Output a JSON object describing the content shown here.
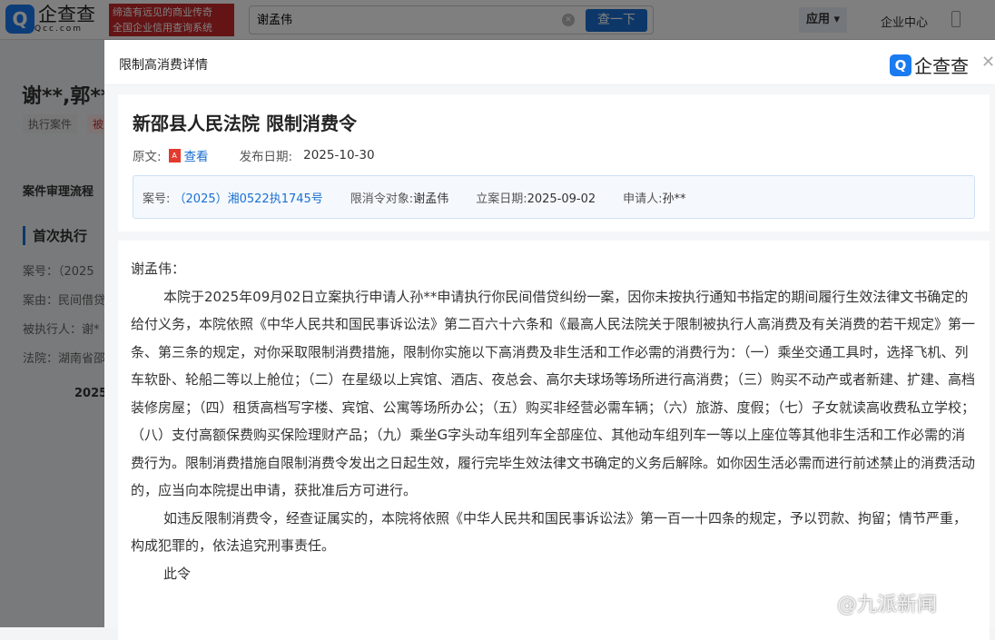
{
  "topbar": {
    "logo_mark": "Q",
    "logo_text": "企查查",
    "logo_sub": "Qcc.com",
    "slogan1": "缔造有远见的商业传奇",
    "slogan2": "全国企业信用查询系统",
    "search_value": "谢孟伟",
    "search_button": "查一下",
    "apps": "应用 ▾",
    "enterprise": "企业中心"
  },
  "background": {
    "title": "谢**,郭**",
    "tag1": "执行案件",
    "tag2": "被",
    "section": "案件审理流程",
    "sub": "首次执行",
    "rows": [
      "案号：（2025",
      "案由：民间借贷",
      "被执行人：谢*",
      "法院：湖南省邵"
    ],
    "year": "2025"
  },
  "modal": {
    "title": "限制高消费详情",
    "logo_text": "企查查",
    "close": "✕",
    "doc_title": "新邵县人民法院 限制消费令",
    "orig_label": "原文:",
    "view": "查看",
    "date_label": "发布日期:",
    "date": "2025-10-30",
    "info": {
      "case_label": "案号:",
      "case_no": "（2025）湘0522执1745号",
      "target_label": "限消令对象:",
      "target": "谢孟伟",
      "filed_label": "立案日期:",
      "filed": "2025-09-02",
      "applicant_label": "申请人:",
      "applicant": "孙**"
    },
    "body": [
      "谢孟伟：",
      "本院于2025年09月02日立案执行申请人孙**申请执行你民间借贷纠纷一案，因你未按执行通知书指定的期间履行生效法律文书确定的给付义务，本院依照《中华人民共和国民事诉讼法》第二百六十六条和《最高人民法院关于限制被执行人高消费及有关消费的若干规定》第一条、第三条的规定，对你采取限制消费措施，限制你实施以下高消费及非生活和工作必需的消费行为：（一）乘坐交通工具时，选择飞机、列车软卧、轮船二等以上舱位；（二）在星级以上宾馆、酒店、夜总会、高尔夫球场等场所进行高消费；（三）购买不动产或者新建、扩建、高档装修房屋；（四）租赁高档写字楼、宾馆、公寓等场所办公；（五）购买非经营必需车辆；（六）旅游、度假；（七）子女就读高收费私立学校；（八）支付高额保费购买保险理财产品；（九）乘坐G字头动车组列车全部座位、其他动车组列车一等以上座位等其他非生活和工作必需的消费行为。限制消费措施自限制消费令发出之日起生效，履行完毕生效法律文书确定的义务后解除。如你因生活必需而进行前述禁止的消费活动的，应当向本院提出申请，获批准后方可进行。",
      "如违反限制消费令，经查证属实的，本院将依照《中华人民共和国民事诉讼法》第一百一十四条的规定，予以罚款、拘留；情节严重，构成犯罪的，依法追究刑事责任。",
      "此令"
    ]
  },
  "watermark": "@九派新闻"
}
